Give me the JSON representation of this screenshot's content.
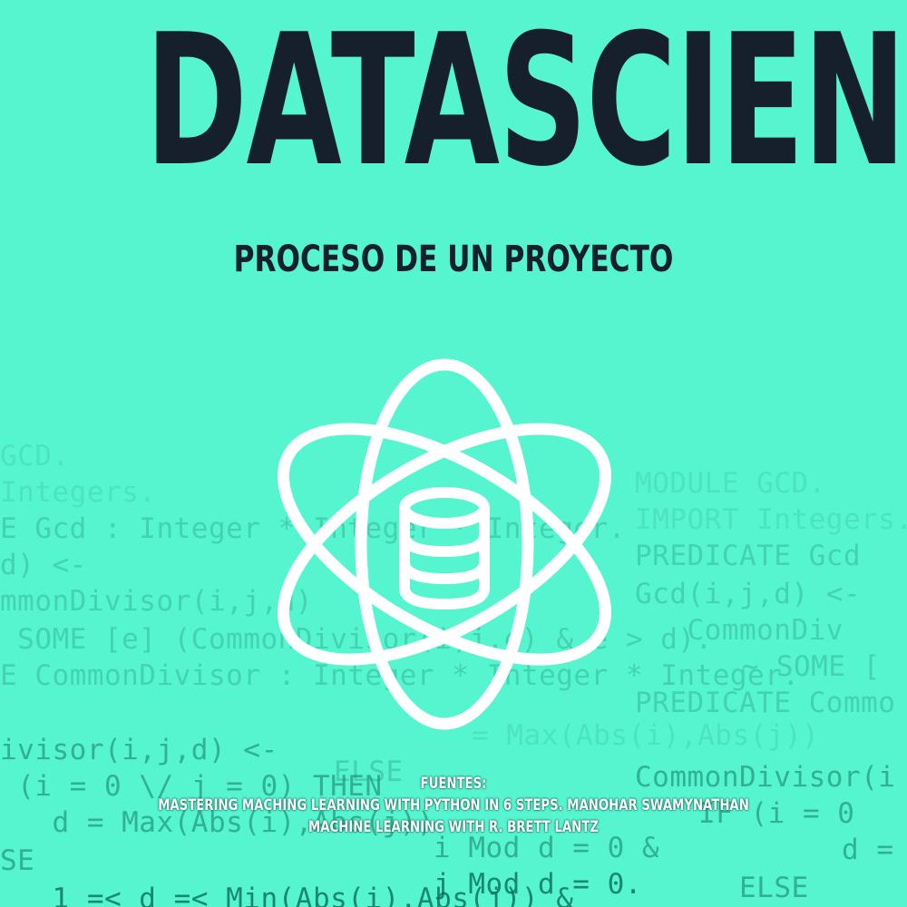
{
  "title": "DATASCIENCE",
  "subtitle": "PROCESO DE UN PROYECTO",
  "logo": {
    "icon": "atom-database-icon",
    "color": "#ffffff"
  },
  "sources": {
    "heading": "FUENTES:",
    "line1": "MASTERING MACHING LEARNING WITH PYTHON IN 6 STEPS. MANOHAR SWAMYNATHAN",
    "line2": "MACHINE LEARNING WITH R. BRETT LANTZ"
  },
  "colors": {
    "background": "#55f5d0",
    "title": "#161f2c",
    "code": "#0f7a62"
  },
  "code_left": [
    "GCD.",
    "Integers.",
    "E Gcd : Integer * Integer * Integer.",
    "d) <-",
    "mmonDivisor(i,j,d)",
    " SOME [e] (CommonDivisor(i,j,e) & e > d).",
    "E CommonDivisor : Integer * Integer * Integer.",
    "ivisor(i,j,d) <-",
    " (i = 0 \\/ j = 0) THEN",
    "   d = Max(Abs(i),Abs(j))",
    "SE",
    "   1 =< d =< Min(Abs(i),Abs(j)) &"
  ],
  "code_right": [
    "MODULE GCD.",
    "IMPORT Integers.",
    "PREDICATE Gcd",
    "Gcd(i,j,d) <-",
    "   CommonDiv",
    "   ~ SOME [",
    "PREDICATE Commo",
    "= Max(Abs(i),Abs(j))",
    "CommonDivisor(i",
    "IF (i = 0",
    "ELSE",
    "i Mod d = 0 &",
    "d =",
    "j Mod d = 0.",
    "ELSE"
  ]
}
